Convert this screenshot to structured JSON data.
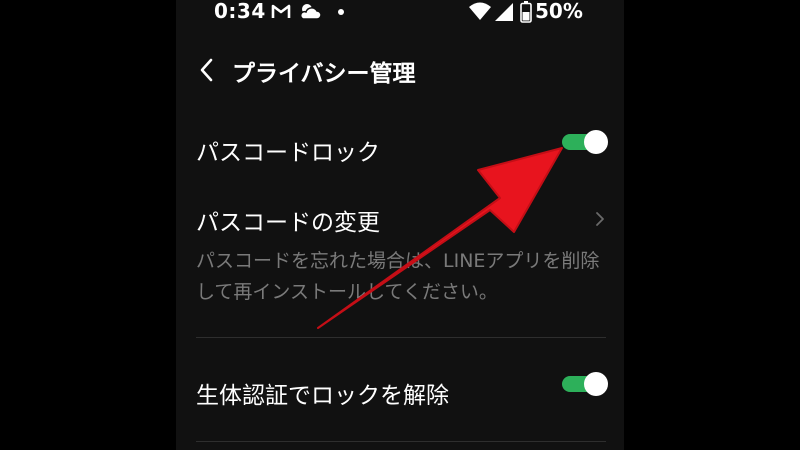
{
  "status_bar": {
    "time": "0:34",
    "battery": "50%",
    "icons": [
      "gmail-icon",
      "weather-icon",
      "dot-icon",
      "wifi-icon",
      "signal-icon",
      "battery-icon"
    ]
  },
  "header": {
    "back_icon": "chevron-left-icon",
    "title": "プライバシー管理"
  },
  "settings": {
    "passcode_lock": {
      "label": "パスコードロック",
      "enabled": true
    },
    "change_passcode": {
      "label": "パスコードの変更",
      "description": "パスコードを忘れた場合は、LINEアプリを削除して再インストールしてください。"
    },
    "biometric_unlock": {
      "label": "生体認証でロックを解除",
      "enabled": true
    }
  },
  "colors": {
    "background": "#111111",
    "toggle_on": "#2db05a",
    "annotation_arrow": "#e8141e",
    "description_text": "#7a7a7a"
  }
}
